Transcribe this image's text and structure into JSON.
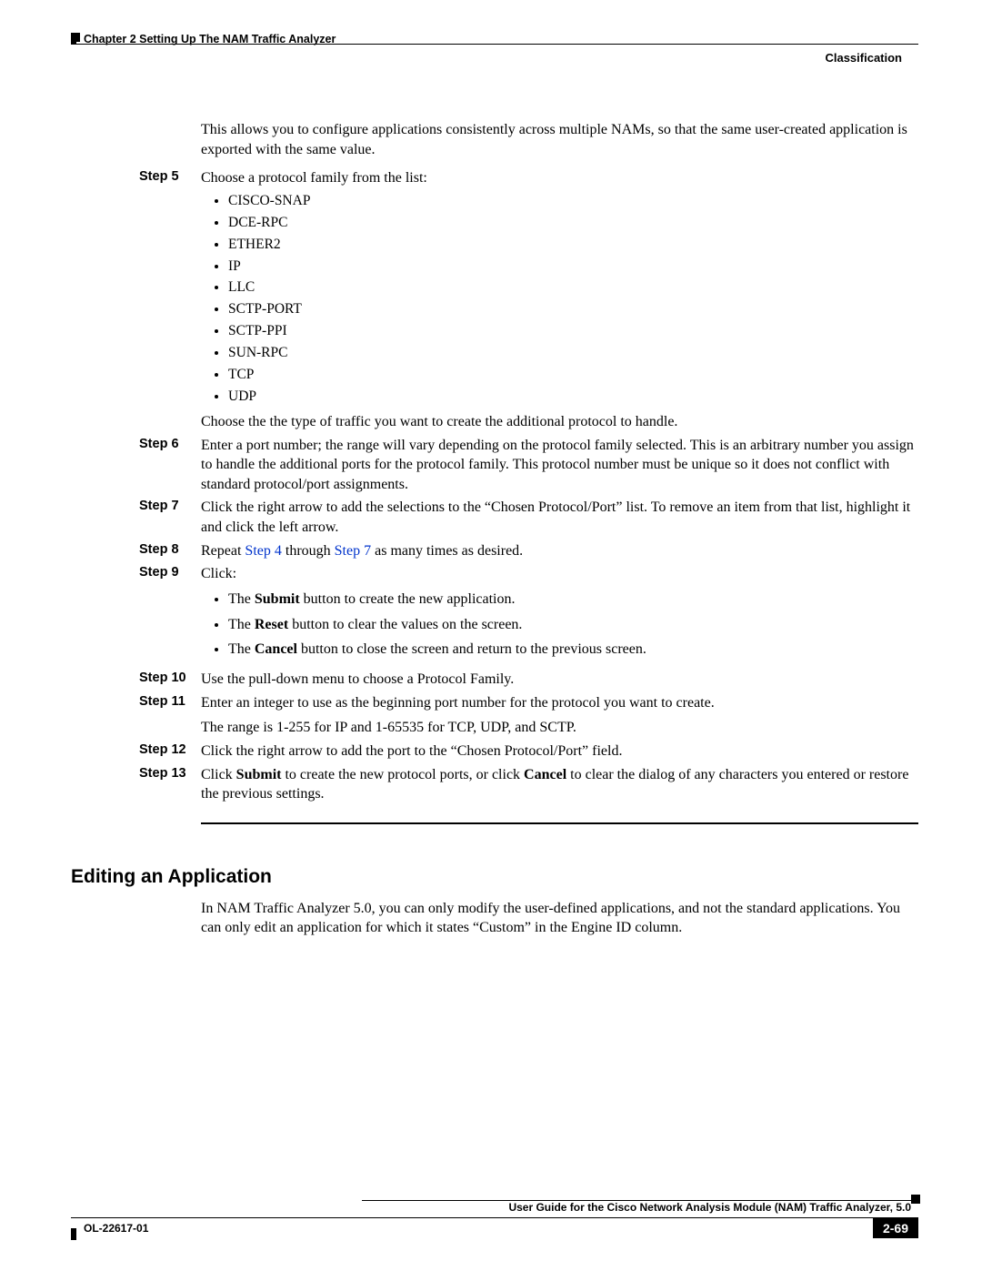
{
  "header": {
    "chapter": "Chapter 2      Setting Up The NAM Traffic Analyzer",
    "section": "Classification"
  },
  "intro": "This allows you to configure applications consistently across multiple NAMs, so that the same user-created application is exported with the same value.",
  "step5": {
    "label": "Step 5",
    "lead": "Choose a protocol family from the list:",
    "items": [
      "CISCO-SNAP",
      "DCE-RPC",
      "ETHER2",
      "IP",
      "LLC",
      "SCTP-PORT",
      "SCTP-PPI",
      "SUN-RPC",
      "TCP",
      "UDP"
    ],
    "trail": "Choose the the type of traffic you want to create the additional protocol to handle."
  },
  "step6": {
    "label": "Step 6",
    "body": "Enter a port number; the range will vary depending on the protocol family selected. This is an arbitrary number you assign to handle the additional ports for the protocol family. This protocol number must be unique so it does not conflict with standard protocol/port assignments."
  },
  "step7": {
    "label": "Step 7",
    "body": "Click the right arrow to add the selections to the “Chosen Protocol/Port” list. To remove an item from that list, highlight it and click the left arrow."
  },
  "step8": {
    "label": "Step 8",
    "pre": "Repeat ",
    "link1": "Step 4",
    "mid": " through ",
    "link2": "Step 7",
    "post": " as many times as desired."
  },
  "step9": {
    "label": "Step 9",
    "body": "Click:",
    "b1a": "The ",
    "b1b": "Submit",
    "b1c": " button to create the new application.",
    "b2a": "The ",
    "b2b": "Reset",
    "b2c": " button to clear the values on the screen.",
    "b3a": "The ",
    "b3b": "Cancel",
    "b3c": " button to close the screen and return to the previous screen."
  },
  "step10": {
    "label": "Step 10",
    "body": "Use the pull-down menu to choose a Protocol Family."
  },
  "step11": {
    "label": "Step 11",
    "body": "Enter an integer to use as the beginning port number for the protocol you want to create.",
    "body2": "The range is 1-255 for IP and 1-65535 for TCP, UDP, and SCTP."
  },
  "step12": {
    "label": "Step 12",
    "body": "Click the right arrow to add the port to the “Chosen Protocol/Port” field."
  },
  "step13": {
    "label": "Step 13",
    "pre": "Click ",
    "b1": "Submit",
    "mid": " to create the new protocol ports, or click ",
    "b2": "Cancel",
    "post": " to clear the dialog of any characters you entered or restore the previous settings."
  },
  "heading": "Editing an Application",
  "editing_para": "In NAM Traffic Analyzer 5.0, you can only modify the user-defined applications, and not the standard applications. You can only edit an application for which it states “Custom” in the Engine ID column.",
  "footer": {
    "title": "User Guide for the Cisco Network Analysis Module (NAM) Traffic Analyzer, 5.0",
    "doc_id": "OL-22617-01",
    "page": "2-69"
  }
}
